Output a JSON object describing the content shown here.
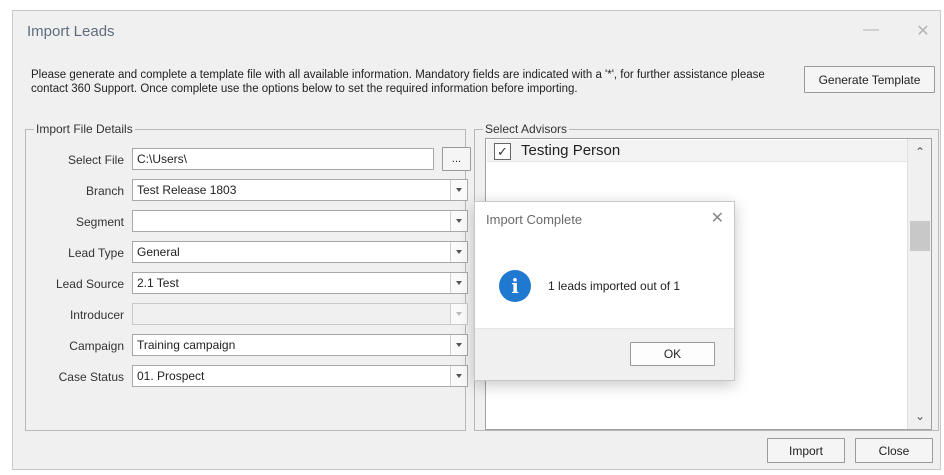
{
  "window": {
    "title": "Import Leads",
    "minimize_glyph": "—",
    "close_glyph": "✕"
  },
  "intro": {
    "text": "Please generate and complete a template file with all available information. Mandatory fields are indicated with a '*', for further assistance please contact 360 Support. Once complete use the options below to set the required information before importing."
  },
  "buttons": {
    "generate_template": "Generate Template",
    "browse": "...",
    "import": "Import",
    "close": "Close"
  },
  "file_details": {
    "group_label": "Import File Details",
    "select_file": {
      "label": "Select File",
      "value": "C:\\Users\\"
    },
    "branch": {
      "label": "Branch",
      "value": "Test Release 1803"
    },
    "segment": {
      "label": "Segment",
      "value": ""
    },
    "lead_type": {
      "label": "Lead Type",
      "value": "General"
    },
    "lead_source": {
      "label": "Lead Source",
      "value": "2.1 Test"
    },
    "introducer": {
      "label": "Introducer",
      "value": ""
    },
    "campaign": {
      "label": "Campaign",
      "value": "Training campaign"
    },
    "case_status": {
      "label": "Case Status",
      "value": "01. Prospect"
    }
  },
  "advisors": {
    "group_label": "Select Advisors",
    "items": [
      {
        "label": "Testing Person",
        "checked": true,
        "check_glyph": "✓"
      }
    ],
    "scroll_up_glyph": "⌃",
    "scroll_down_glyph": "⌄"
  },
  "dialog": {
    "title": "Import Complete",
    "close_glyph": "✕",
    "icon": "info-icon",
    "icon_glyph": "i",
    "message": "1 leads imported out of 1",
    "ok_label": "OK",
    "icon_color": "#1f79d1"
  }
}
